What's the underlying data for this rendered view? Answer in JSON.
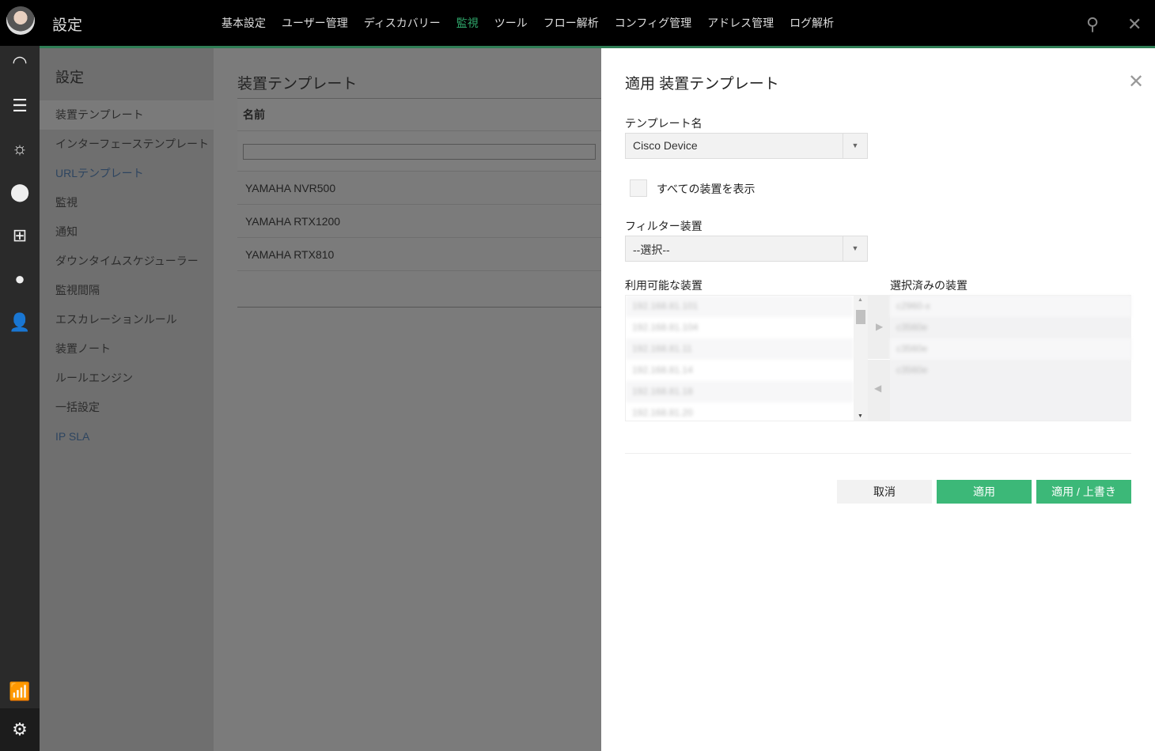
{
  "header": {
    "title": "設定",
    "nav": [
      "基本設定",
      "ユーザー管理",
      "ディスカバリー",
      "監視",
      "ツール",
      "フロー解析",
      "コンフィグ管理",
      "アドレス管理",
      "ログ解析"
    ],
    "active_nav": "監視"
  },
  "colors": {
    "accent": "#2fa56a",
    "button_green": "#3cb878"
  },
  "sidebar": {
    "title": "設定",
    "items": [
      "装置テンプレート",
      "インターフェーステンプレート",
      "URLテンプレート",
      "監視",
      "通知",
      "ダウンタイムスケジューラー",
      "監視間隔",
      "エスカレーションルール",
      "装置ノート",
      "ルールエンジン",
      "一括設定",
      "IP SLA"
    ],
    "selected": "装置テンプレート"
  },
  "content": {
    "title": "装置テンプレート",
    "column": "名前",
    "rows": [
      "YAMAHA NVR500",
      "YAMAHA RTX1200",
      "YAMAHA RTX810"
    ]
  },
  "dialog": {
    "title": "適用 装置テンプレート",
    "template_label": "テンプレート名",
    "template_value": "Cisco Device",
    "show_all_label": "すべての装置を表示",
    "filter_label": "フィルター装置",
    "filter_value": "--選択--",
    "available_label": "利用可能な装置",
    "selected_label": "選択済みの装置",
    "available": [
      "192.168.81.101",
      "192.168.81.104",
      "192.168.81.11",
      "192.168.81.14",
      "192.168.81.18",
      "192.168.81.20"
    ],
    "selected": [
      "c2960-x",
      "c3560e",
      "c3560e",
      "c3560e"
    ],
    "cancel": "取消",
    "apply": "適用",
    "apply_overwrite": "適用 / 上書き"
  }
}
